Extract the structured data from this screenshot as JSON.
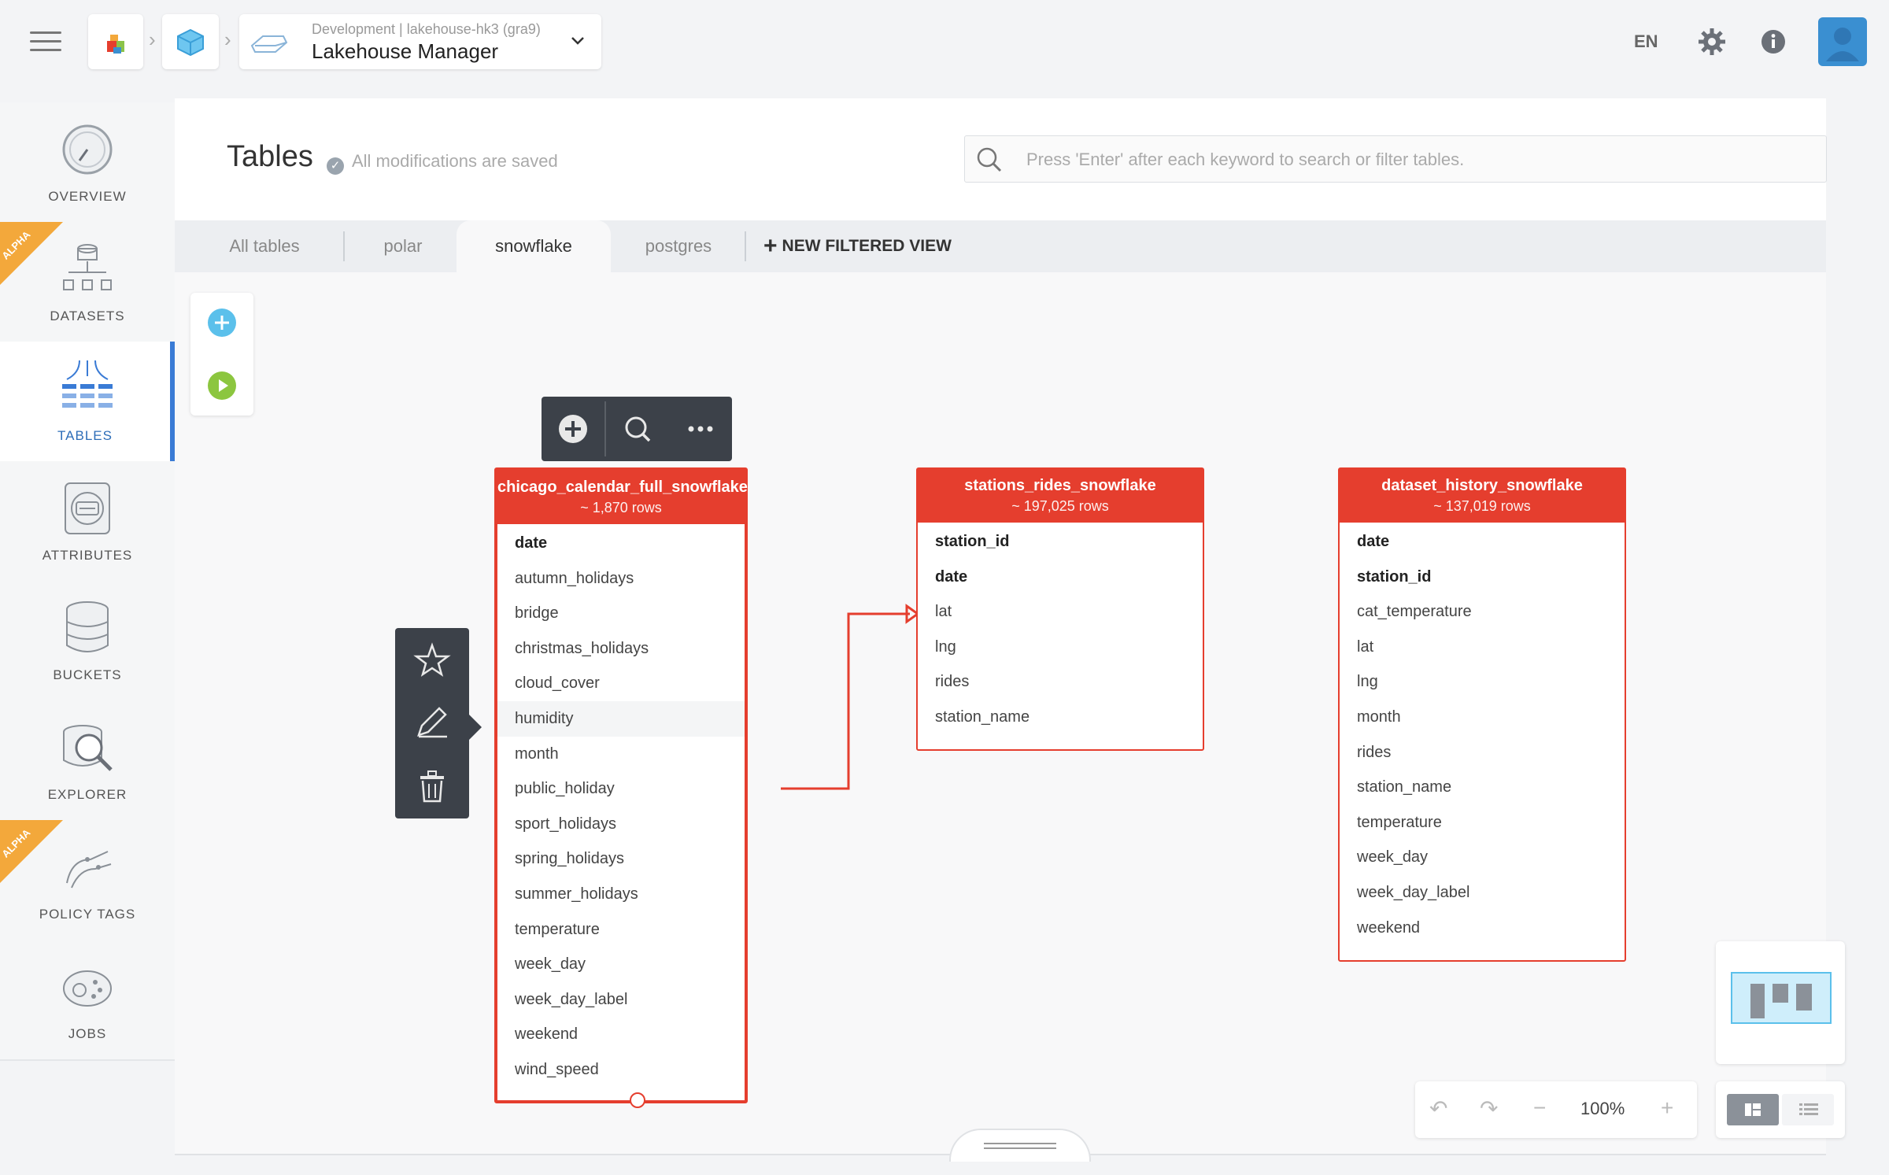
{
  "header": {
    "project_subtitle": "Development | lakehouse-hk3 (gra9)",
    "project_title": "Lakehouse Manager",
    "language": "EN"
  },
  "sidebar": {
    "items": [
      {
        "label": "OVERVIEW",
        "icon": "gauge-icon"
      },
      {
        "label": "DATASETS",
        "icon": "datasets-icon",
        "badge": "ALPHA"
      },
      {
        "label": "TABLES",
        "icon": "tables-icon",
        "active": true
      },
      {
        "label": "ATTRIBUTES",
        "icon": "attributes-icon"
      },
      {
        "label": "BUCKETS",
        "icon": "buckets-icon"
      },
      {
        "label": "EXPLORER",
        "icon": "explorer-icon"
      },
      {
        "label": "POLICY TAGS",
        "icon": "policy-tags-icon",
        "badge": "ALPHA"
      },
      {
        "label": "JOBS",
        "icon": "jobs-icon"
      }
    ]
  },
  "page": {
    "title": "Tables",
    "save_status": "All modifications are saved",
    "search_placeholder": "Press 'Enter' after each keyword to search or filter tables."
  },
  "tabs": {
    "items": [
      "All tables",
      "polar",
      "snowflake",
      "postgres"
    ],
    "active": "snowflake",
    "new_view": "NEW FILTERED VIEW"
  },
  "tables": [
    {
      "name": "chicago_calendar_full_snowflake",
      "rows": "~ 1,870 rows",
      "fields": [
        "date",
        "autumn_holidays",
        "bridge",
        "christmas_holidays",
        "cloud_cover",
        "humidity",
        "month",
        "public_holiday",
        "sport_holidays",
        "spring_holidays",
        "summer_holidays",
        "temperature",
        "week_day",
        "week_day_label",
        "weekend",
        "wind_speed"
      ],
      "key_fields": [
        "date"
      ],
      "highlighted_field": "humidity"
    },
    {
      "name": "stations_rides_snowflake",
      "rows": "~ 197,025 rows",
      "fields": [
        "station_id",
        "date",
        "lat",
        "lng",
        "rides",
        "station_name"
      ],
      "key_fields": [
        "station_id",
        "date"
      ]
    },
    {
      "name": "dataset_history_snowflake",
      "rows": "~ 137,019 rows",
      "fields": [
        "date",
        "station_id",
        "cat_temperature",
        "lat",
        "lng",
        "month",
        "rides",
        "station_name",
        "temperature",
        "week_day",
        "week_day_label",
        "weekend"
      ],
      "key_fields": [
        "date",
        "station_id"
      ]
    }
  ],
  "zoom": {
    "value": "100%"
  },
  "colors": {
    "table_accent": "#e53e2e",
    "active_nav": "#3a7bd5",
    "alpha_badge": "#f3a83b"
  }
}
